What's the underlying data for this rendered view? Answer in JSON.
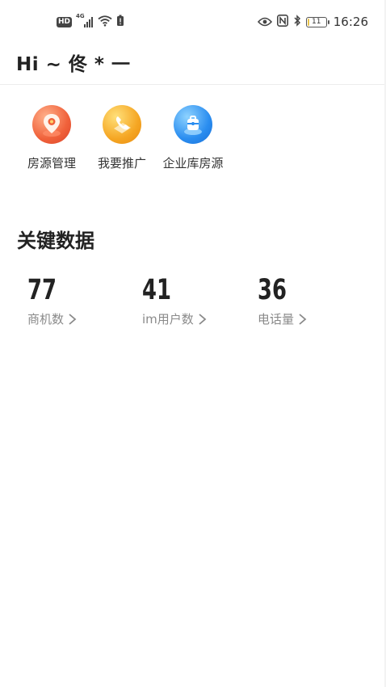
{
  "status_bar": {
    "network_badge": "HD",
    "network_gen": "4G",
    "battery_text": "11",
    "battery_level": 0.11,
    "clock": "16:26"
  },
  "header": {
    "greeting": "Hi ~ 佟 * 一"
  },
  "quick_menu": {
    "items": [
      {
        "label": "房源管理",
        "icon": "location-pin-icon",
        "color": "#f0613a"
      },
      {
        "label": "我要推广",
        "icon": "phone-promo-icon",
        "color": "#f5a623"
      },
      {
        "label": "企业库房源",
        "icon": "building-icon",
        "color": "#2a8df0"
      }
    ]
  },
  "key_data": {
    "title": "关键数据",
    "stats": [
      {
        "value": "77",
        "label": "商机数"
      },
      {
        "value": "41",
        "label": "im用户数"
      },
      {
        "value": "36",
        "label": "电话量"
      }
    ]
  }
}
